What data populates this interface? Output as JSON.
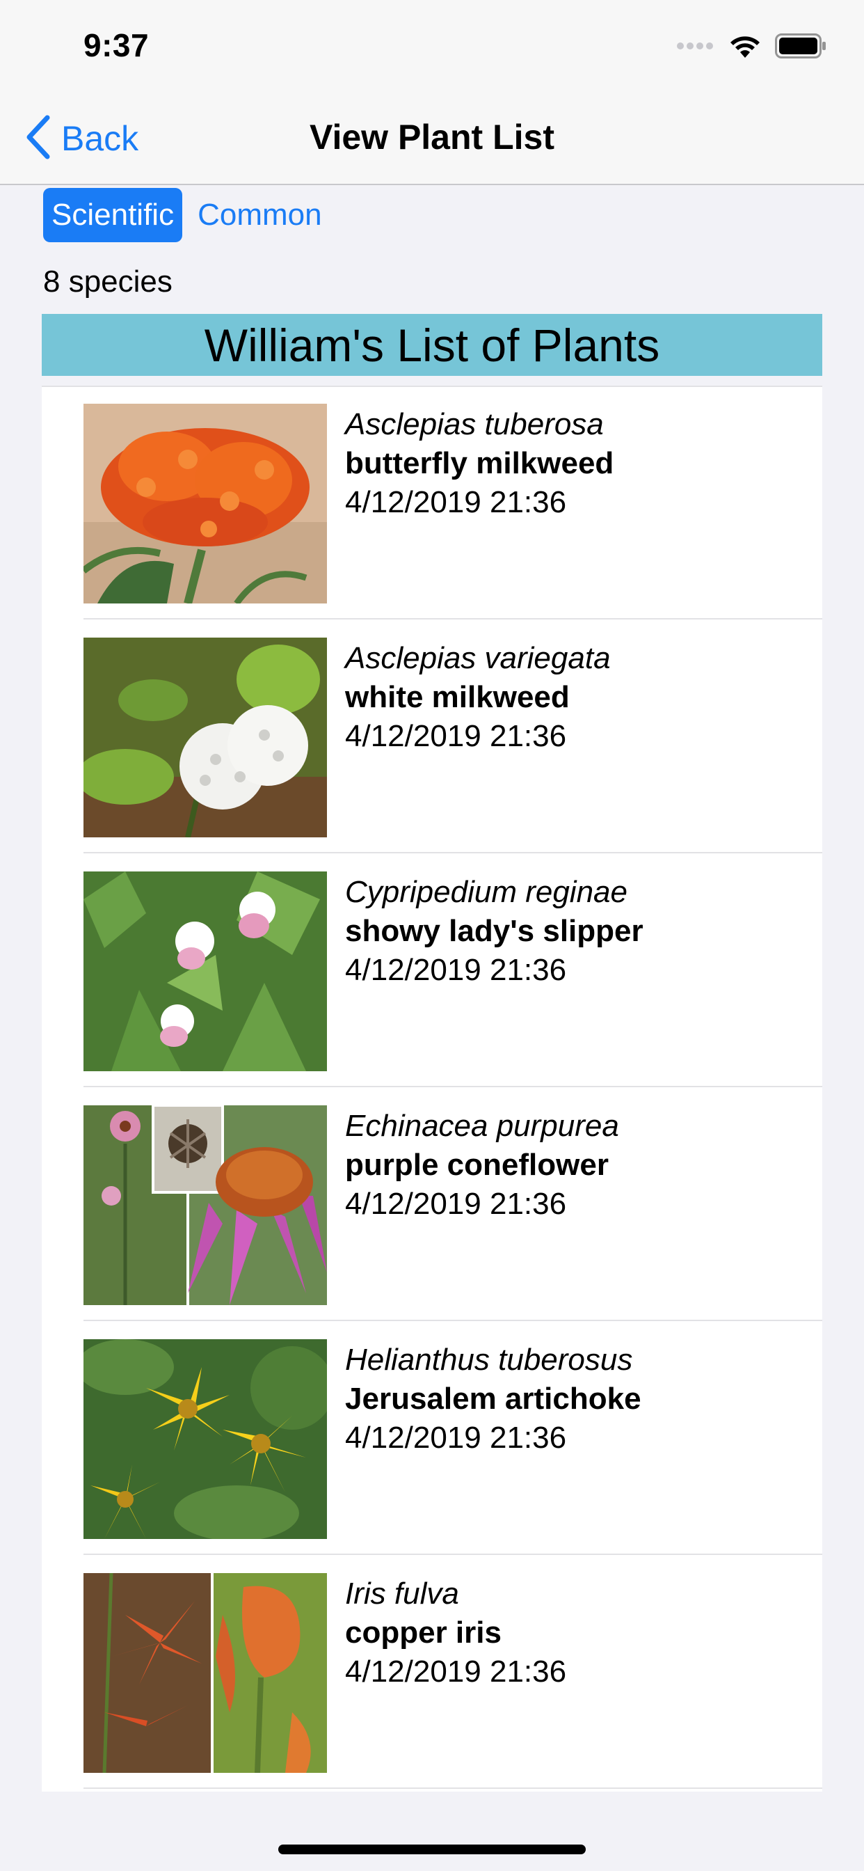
{
  "status_bar": {
    "time": "9:37",
    "icons": [
      "cellular-signal-icon",
      "wifi-icon",
      "battery-icon"
    ]
  },
  "nav": {
    "back_label": "Back",
    "title": "View Plant List",
    "back_icon": "chevron-left-icon"
  },
  "segments": {
    "scientific": "Scientific",
    "common": "Common",
    "selected": "Scientific"
  },
  "species_count": "8 species",
  "list_title": "William's List of Plants",
  "plants": [
    {
      "scientific": "Asclepias tuberosa",
      "common": "butterfly milkweed",
      "date": "4/12/2019 21:36"
    },
    {
      "scientific": "Asclepias variegata",
      "common": "white milkweed",
      "date": "4/12/2019 21:36"
    },
    {
      "scientific": "Cypripedium reginae",
      "common": "showy lady's slipper",
      "date": "4/12/2019 21:36"
    },
    {
      "scientific": "Echinacea purpurea",
      "common": "purple coneflower",
      "date": "4/12/2019 21:36"
    },
    {
      "scientific": "Helianthus tuberosus",
      "common": "Jerusalem artichoke",
      "date": "4/12/2019 21:36"
    },
    {
      "scientific": "Iris fulva",
      "common": "copper iris",
      "date": "4/12/2019 21:36"
    }
  ],
  "colors": {
    "accent": "#1a7cf5",
    "header_bg": "#76c5d7",
    "page_bg": "#f2f2f7",
    "list_bg": "#ffffff"
  }
}
